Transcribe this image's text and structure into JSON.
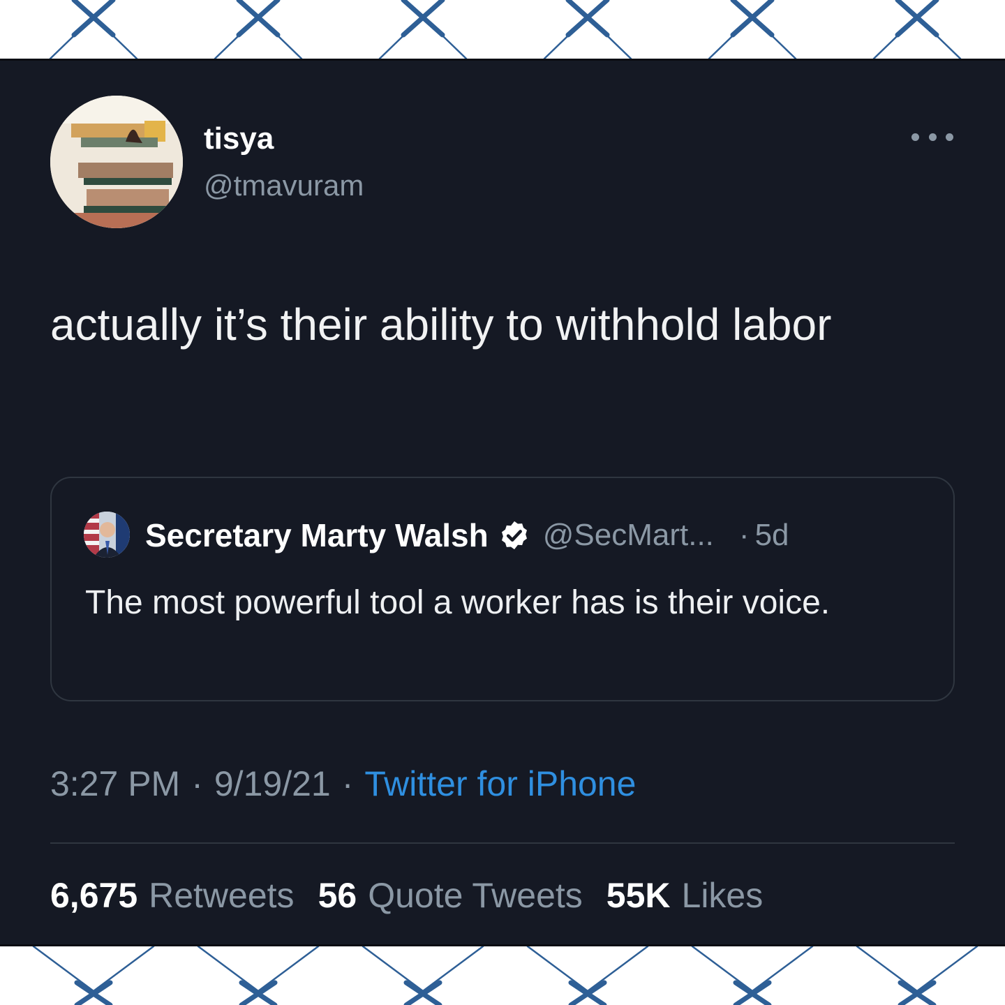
{
  "colors": {
    "background": "#151924",
    "text_primary": "#e7e9ea",
    "text_secondary": "#8b98a5",
    "link": "#2f8fe0",
    "frame_pattern": "#2e5f96",
    "verified_badge": "#ffffff"
  },
  "tweet": {
    "display_name": "tisya",
    "handle": "@tmavuram",
    "text": "actually it’s their ability to withhold labor",
    "more_icon": "ellipsis-icon",
    "quoted": {
      "display_name": "Secretary Marty Walsh",
      "verified_icon": "verified-badge-icon",
      "handle": "@SecMart...",
      "separator": "·",
      "time": "5d",
      "text": "The most powerful tool a worker has is their voice."
    },
    "meta": {
      "time": "3:27 PM",
      "separator": "·",
      "date": "9/19/21",
      "source": "Twitter for iPhone"
    },
    "stats": [
      {
        "value": "6,675",
        "label": "Retweets"
      },
      {
        "value": "56",
        "label": "Quote Tweets"
      },
      {
        "value": "55K",
        "label": "Likes"
      }
    ]
  }
}
